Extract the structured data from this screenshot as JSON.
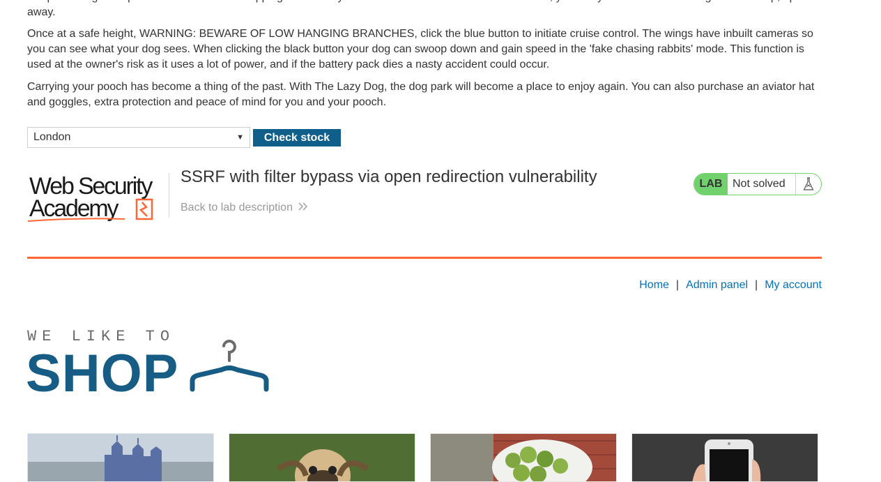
{
  "description": {
    "p0": "Snap the wings into place and click the red 'flapping' button on your handheld remote. After a few seconds, your furry friend will be off the ground and up, up and away.",
    "p1": "Once at a safe height, WARNING: BEWARE OF LOW HANGING BRANCHES, click the blue button to initiate cruise control. The wings have inbuilt cameras so you can see what your dog sees. When clicking the black button your dog can swoop down and gain speed in the 'fake chasing rabbits' mode. This function is used at the owner's risk as it uses a lot of power, and if the battery pack dies a nasty accident could occur.",
    "p2": "Carrying your pooch has become a thing of the past. With The Lazy Dog, the dog park will become a place to enjoy again. You can also purchase an aviator hat and goggles, extra protection and peace of mind for you and your pooch."
  },
  "stock": {
    "selected_store": "London",
    "button_label": "Check stock"
  },
  "academy": {
    "logo_line1": "Web Security",
    "logo_line2": "Academy",
    "lab_title": "SSRF with filter bypass via open redirection vulnerability",
    "back_link": "Back to lab description",
    "badge_tag": "LAB",
    "badge_status": "Not solved"
  },
  "nav": {
    "home": "Home",
    "admin": "Admin panel",
    "account": "My account",
    "separator": "|"
  },
  "shop_logo": {
    "tagline": "WE LIKE TO",
    "word": "SHOP"
  },
  "colors": {
    "accent_blue": "#0f5f8a",
    "link_blue": "#0071bc",
    "orange": "#ff6633",
    "lab_green": "#70d16d"
  }
}
